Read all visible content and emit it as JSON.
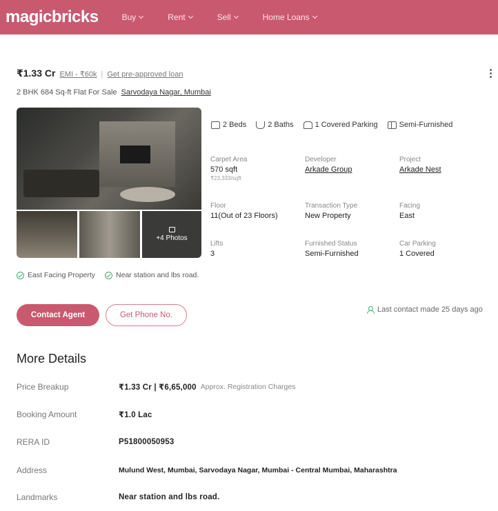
{
  "header": {
    "logo": "magicbricks",
    "nav": [
      "Buy",
      "Rent",
      "Sell",
      "Home Loans"
    ]
  },
  "listing": {
    "price": "₹1.33 Cr",
    "emi": "EMI - ₹60k",
    "separator": "|",
    "loan_link": "Get pre-approved loan",
    "subtitle": "2 BHK 684 Sq-ft Flat For Sale",
    "locality": "Sarvodaya Nagar, Mumbai",
    "photos_label": "+4 Photos"
  },
  "features": [
    {
      "icon": "bed-icon",
      "label": "2 Beds"
    },
    {
      "icon": "bath-icon",
      "label": "2 Baths"
    },
    {
      "icon": "car-icon",
      "label": "1 Covered Parking"
    },
    {
      "icon": "furniture-icon",
      "label": "Semi-Furnished"
    }
  ],
  "details": {
    "carpet_area": {
      "label": "Carpet Area",
      "value": "570 sqft",
      "sub": "₹23,333/sqft"
    },
    "developer": {
      "label": "Developer",
      "value": "Arkade Group"
    },
    "project": {
      "label": "Project",
      "value": "Arkade Nest"
    },
    "floor": {
      "label": "Floor",
      "value": "11(Out of 23 Floors)"
    },
    "transaction": {
      "label": "Transaction Type",
      "value": "New Property"
    },
    "facing": {
      "label": "Facing",
      "value": "East"
    },
    "lifts": {
      "label": "Lifts",
      "value": "3"
    },
    "furnished": {
      "label": "Furnished Status",
      "value": "Semi-Furnished"
    },
    "car_parking": {
      "label": "Car Parking",
      "value": "1 Covered"
    }
  },
  "tags": [
    "East Facing Property",
    "Near station and lbs road."
  ],
  "actions": {
    "contact_agent": "Contact Agent",
    "get_phone": "Get Phone No.",
    "last_contact": "Last contact made 25 days ago"
  },
  "more_details": {
    "title": "More Details",
    "rows": [
      {
        "label": "Price Breakup",
        "value": "₹1.33 Cr | ₹6,65,000",
        "note": "Approx. Registration Charges"
      },
      {
        "label": "Booking Amount",
        "value": "₹1.0 Lac",
        "note": ""
      },
      {
        "label": "RERA ID",
        "value": "P51800050953",
        "note": ""
      },
      {
        "label": "Address",
        "value": "Mulund West, Mumbai, Sarvodaya Nagar, Mumbai - Central Mumbai, Maharashtra",
        "note": ""
      },
      {
        "label": "Landmarks",
        "value": "Near station and lbs road.",
        "note": ""
      }
    ]
  },
  "colors": {
    "brand": "#c9596f",
    "success": "#3fae6a"
  }
}
